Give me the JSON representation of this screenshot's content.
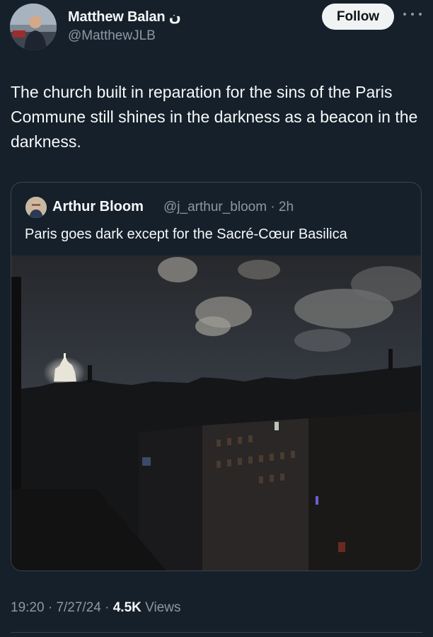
{
  "author": {
    "display_name": "Matthew Balan ن",
    "handle": "@MatthewJLB"
  },
  "follow_label": "Follow",
  "tweet_text": "The church built in reparation for the sins of the Paris Commune still shines in the darkness as a beacon in the darkness.",
  "quoted": {
    "display_name": "Arthur Bloom",
    "handle": "@j_arthur_bloom",
    "separator": "·",
    "time": "2h",
    "text": "Paris goes dark except for the Sacré-Cœur Basilica"
  },
  "footer": {
    "time": "19:20",
    "sep1": "·",
    "date": "7/27/24",
    "sep2": "·",
    "views_count": "4.5K",
    "views_label": "Views"
  },
  "icons": {
    "more": "more-horizontal-icon"
  },
  "colors": {
    "background": "#15202b",
    "text_primary": "#f7f9f9",
    "text_secondary": "#8b98a5",
    "border": "#38444d",
    "follow_bg": "#eff3f4"
  }
}
